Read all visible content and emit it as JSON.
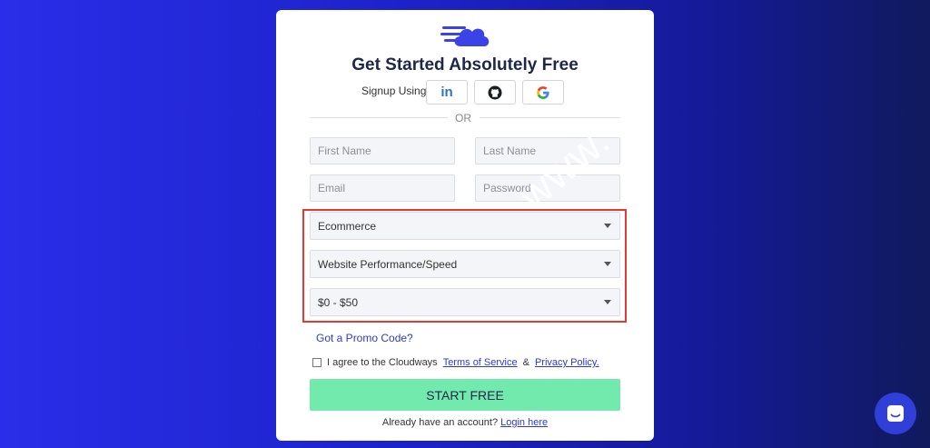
{
  "form": {
    "title": "Get Started Absolutely Free",
    "signup_label": "Signup Using",
    "or_text": "OR",
    "first_name_placeholder": "First Name",
    "last_name_placeholder": "Last Name",
    "email_placeholder": "Email",
    "password_placeholder": "Password",
    "selects": [
      "Ecommerce",
      "Website Performance/Speed",
      "$0 - $50"
    ],
    "promo_link": "Got a Promo Code?",
    "agree_text": "I agree to the Cloudways",
    "terms_link": "Terms of Service",
    "amp": "&",
    "privacy_link": "Privacy Policy.",
    "start_button": "START FREE",
    "have_account": "Already have an account?",
    "login_link": "Login here"
  },
  "social": [
    "linkedin-icon",
    "github-icon",
    "google-icon"
  ],
  "watermark": "www.  ",
  "colors": {
    "accent_button": "#73eaad",
    "link": "#2b3bd1",
    "highlight_box": "#e53935"
  }
}
